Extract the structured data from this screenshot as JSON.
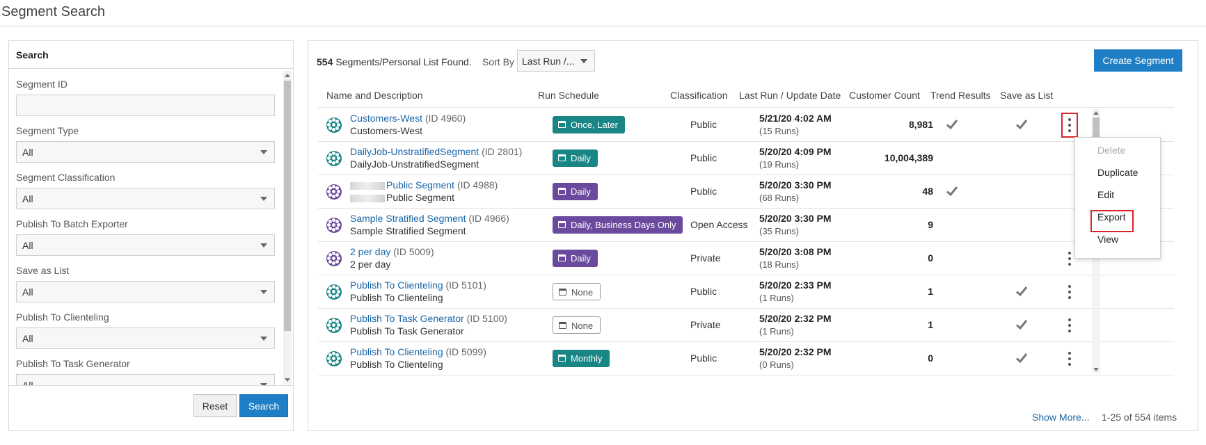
{
  "page": {
    "title": "Segment Search"
  },
  "search": {
    "header": "Search",
    "fields": [
      {
        "label": "Segment ID",
        "type": "text",
        "value": ""
      },
      {
        "label": "Segment Type",
        "type": "select",
        "value": "All"
      },
      {
        "label": "Segment Classification",
        "type": "select",
        "value": "All"
      },
      {
        "label": "Publish To Batch Exporter",
        "type": "select",
        "value": "All"
      },
      {
        "label": "Save as List",
        "type": "select",
        "value": "All"
      },
      {
        "label": "Publish To Clienteling",
        "type": "select",
        "value": "All"
      },
      {
        "label": "Publish To Task Generator",
        "type": "select",
        "value": "All"
      }
    ],
    "reset_label": "Reset",
    "search_label": "Search"
  },
  "results": {
    "count": "554",
    "count_text": "Segments/Personal List Found.",
    "sort_label": "Sort By",
    "sort_value": "Last Run /...",
    "create_label": "Create Segment",
    "columns": [
      "Name and Description",
      "Run Schedule",
      "Classification",
      "Last Run / Update Date",
      "Customer Count",
      "Trend Results",
      "Save as List"
    ],
    "rows": [
      {
        "name": "Customers-West",
        "id": "(ID 4960)",
        "desc": "Customers-West",
        "schedule": "Once, Later",
        "schedule_style": "teal",
        "icon": "teal",
        "classification": "Public",
        "date": "5/21/20 4:02 AM",
        "runs": "(15 Runs)",
        "count": "8,981",
        "trend": true,
        "save_list": true
      },
      {
        "name": "DailyJob-UnstratifiedSegment",
        "id": "(ID 2801)",
        "desc": "DailyJob-UnstratifiedSegment",
        "schedule": "Daily",
        "schedule_style": "teal",
        "icon": "teal",
        "classification": "Public",
        "date": "5/20/20 4:09 PM",
        "runs": "(19 Runs)",
        "count": "10,004,389",
        "trend": false,
        "save_list": false
      },
      {
        "name": "Public Segment",
        "id": "(ID 4988)",
        "desc": "Public Segment",
        "blurred": true,
        "schedule": "Daily",
        "schedule_style": "purple",
        "icon": "purple",
        "classification": "Public",
        "date": "5/20/20 3:30 PM",
        "runs": "(68 Runs)",
        "count": "48",
        "trend": true,
        "save_list": false
      },
      {
        "name": "Sample Stratified Segment",
        "id": "(ID 4966)",
        "desc": "Sample Stratified Segment",
        "schedule": "Daily, Business Days Only",
        "schedule_style": "purple",
        "icon": "purple",
        "classification": "Open Access",
        "date": "5/20/20 3:30 PM",
        "runs": "(35 Runs)",
        "count": "9",
        "trend": false,
        "save_list": false
      },
      {
        "name": "2 per day",
        "id": "(ID 5009)",
        "desc": "2 per day",
        "schedule": "Daily",
        "schedule_style": "purple",
        "icon": "purple",
        "classification": "Private",
        "date": "5/20/20 3:08 PM",
        "runs": "(18 Runs)",
        "count": "0",
        "trend": false,
        "save_list": false
      },
      {
        "name": "Publish To Clienteling",
        "id": "(ID 5101)",
        "desc": "Publish To Clienteling",
        "schedule": "None",
        "schedule_style": "none",
        "icon": "teal",
        "classification": "Public",
        "date": "5/20/20 2:33 PM",
        "runs": "(1 Runs)",
        "count": "1",
        "trend": false,
        "save_list": true
      },
      {
        "name": "Publish To Task Generator",
        "id": "(ID 5100)",
        "desc": "Publish To Task Generator",
        "schedule": "None",
        "schedule_style": "none",
        "icon": "teal",
        "classification": "Private",
        "date": "5/20/20 2:32 PM",
        "runs": "(1 Runs)",
        "count": "1",
        "trend": false,
        "save_list": true
      },
      {
        "name": "Publish To Clienteling",
        "id": "(ID 5099)",
        "desc": "Publish To Clienteling",
        "schedule": "Monthly",
        "schedule_style": "teal",
        "icon": "teal",
        "classification": "Public",
        "date": "5/20/20 2:32 PM",
        "runs": "(0 Runs)",
        "count": "0",
        "trend": false,
        "save_list": true
      }
    ],
    "show_more": "Show More...",
    "pager": "1-25 of 554 items"
  },
  "context_menu": {
    "items": [
      "Delete",
      "Duplicate",
      "Edit",
      "Export",
      "View"
    ]
  },
  "colors": {
    "accent_blue": "#1e7fc6",
    "teal": "#198585",
    "purple": "#6a4a9c",
    "highlight_red": "#d8232a"
  }
}
